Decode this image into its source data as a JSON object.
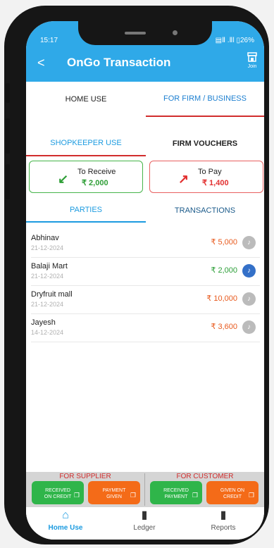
{
  "status": {
    "time": "15:17",
    "right": "▤Ⅱ .Ⅱl ▯26%"
  },
  "header": {
    "title": "OnGo Transaction",
    "back": "<",
    "join_label": "Join",
    "join_icon": "store-icon"
  },
  "top_tabs": {
    "home": "HOME USE",
    "firm": "FOR FIRM / BUSINESS"
  },
  "sub_tabs": {
    "shopkeeper": "SHOPKEEPER USE",
    "vouchers": "FIRM VOUCHERS"
  },
  "cards": {
    "receive": {
      "label": "To Receive",
      "amount": "₹ 2,000",
      "color": "#2e9e36",
      "arrow_icon": "arrow-down-left-icon"
    },
    "pay": {
      "label": "To Pay",
      "amount": "₹ 1,400",
      "color": "#e23030",
      "arrow_icon": "arrow-up-right-icon"
    }
  },
  "list_tabs": {
    "parties": "PARTIES",
    "transactions": "TRANSACTIONS"
  },
  "parties": [
    {
      "name": "Abhinav",
      "date": "21-12-2024",
      "amount": "₹ 5,000",
      "amount_color": "#e85a1e",
      "bell_active": false
    },
    {
      "name": "Balaji Mart",
      "date": "21-12-2024",
      "amount": "₹ 2,000",
      "amount_color": "#2a9e36",
      "bell_active": true
    },
    {
      "name": "Dryfruit mall",
      "date": "21-12-2024",
      "amount": "₹ 10,000",
      "amount_color": "#e85a1e",
      "bell_active": false
    },
    {
      "name": "Jayesh",
      "date": "14-12-2024",
      "amount": "₹ 3,600",
      "amount_color": "#e85a1e",
      "bell_active": false
    }
  ],
  "bottom_panel": {
    "supplier_title": "FOR SUPPLIER",
    "customer_title": "FOR CUSTOMER",
    "buttons": {
      "received_on_credit": [
        "RECEIVED",
        "ON CREDIT"
      ],
      "payment_given": [
        "PAYMENT",
        "GIVEN"
      ],
      "received_payment": [
        "RECEIVED",
        "PAYMENT"
      ],
      "given_on_credit": [
        "GIVEN ON",
        "CREDIT"
      ]
    }
  },
  "nav": {
    "home": "Home Use",
    "ledger": "Ledger",
    "reports": "Reports"
  }
}
